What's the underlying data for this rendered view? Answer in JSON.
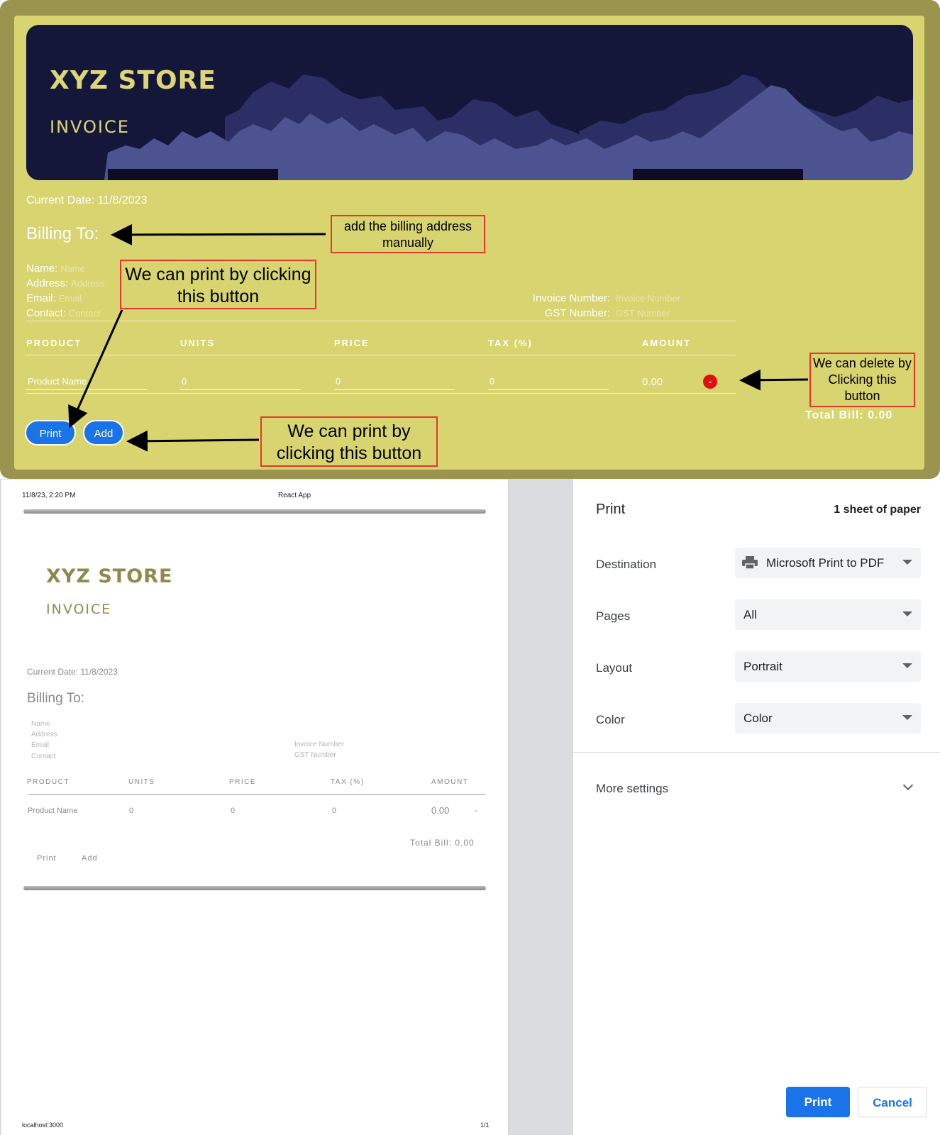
{
  "app": {
    "store_name": "XYZ STORE",
    "doc_title": "INVOICE",
    "current_date": "Current Date: 11/8/2023",
    "billing_heading": "Billing To:",
    "billing_fields": [
      {
        "label": "Name:",
        "placeholder": "Name"
      },
      {
        "label": "Address:",
        "placeholder": "Address"
      },
      {
        "label": "Email:",
        "placeholder": "Email"
      },
      {
        "label": "Contact:",
        "placeholder": "Contact"
      }
    ],
    "invoice_fields": [
      {
        "label": "Invoice Number:",
        "placeholder": "Invoice Number"
      },
      {
        "label": "GST Number:",
        "placeholder": "GST Number"
      }
    ],
    "table_headers": [
      "PRODUCT",
      "UNITS",
      "PRICE",
      "TAX (%)",
      "AMOUNT"
    ],
    "row": {
      "product": "Product Name",
      "units": "0",
      "price": "0",
      "tax": "0",
      "amount": "0.00",
      "delete_label": "-"
    },
    "total": "Total Bill: 0.00",
    "print_label": "Print",
    "add_label": "Add"
  },
  "callouts": {
    "billing": "add the billing address manually",
    "print_top": "We can print by clicking this button",
    "delete": "We can delete by Clicking this button",
    "add": "We can print by clicking this button"
  },
  "preview": {
    "header_left": "11/8/23, 2:20 PM",
    "header_center": "React App",
    "store_name": "XYZ STORE",
    "doc_title": "INVOICE",
    "current_date": "Current Date: 11/8/2023",
    "billing_heading": "Billing To:",
    "billing_placeholders": [
      "Name",
      "Address",
      "Email",
      "Contact"
    ],
    "invoice_placeholders": [
      "Invoice Number",
      "GST Number"
    ],
    "table_headers": [
      "PRODUCT",
      "UNITS",
      "PRICE",
      "TAX (%)",
      "AMOUNT"
    ],
    "row": {
      "product": "Product Name",
      "units": "0",
      "price": "0",
      "tax": "0",
      "amount": "0.00",
      "delete_label": "-"
    },
    "total": "Total Bill: 0.00",
    "print_label": "Print",
    "add_label": "Add",
    "footer_left": "localhost:3000",
    "footer_right": "1/1"
  },
  "dialog": {
    "title": "Print",
    "sheets": "1 sheet of paper",
    "destination_label": "Destination",
    "destination_value": "Microsoft Print to PDF",
    "pages_label": "Pages",
    "pages_value": "All",
    "layout_label": "Layout",
    "layout_value": "Portrait",
    "color_label": "Color",
    "color_value": "Color",
    "more_settings": "More settings",
    "print_button": "Print",
    "cancel_button": "Cancel"
  },
  "colors": {
    "app_bg": "#d8d470",
    "banner_bg": "#15173a",
    "accent_blue": "#1a73e8",
    "callout_border": "#e3382b",
    "delete_red": "#e01010"
  }
}
